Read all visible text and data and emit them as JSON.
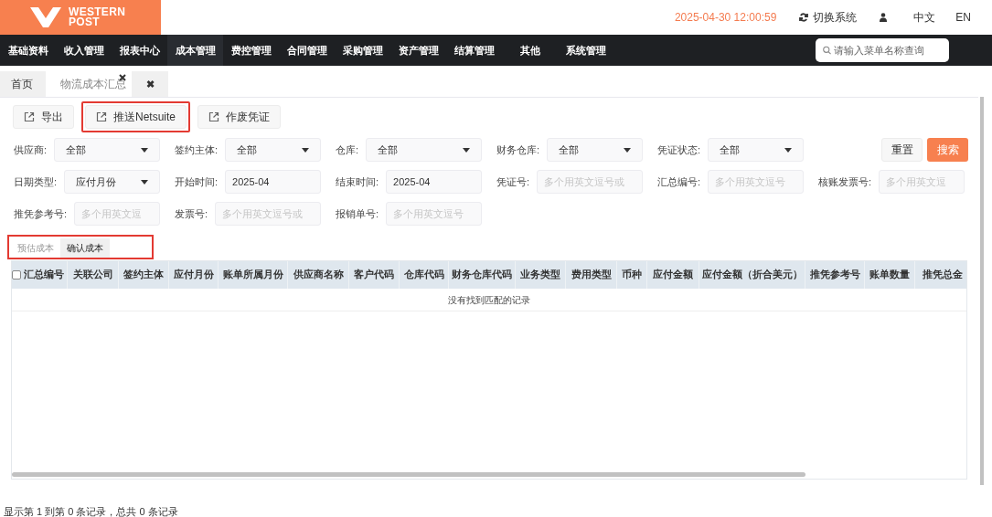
{
  "header": {
    "logo": [
      "WESTERN",
      "POST"
    ],
    "datetime": "2025-04-30 12:00:59",
    "switch_system": "切换系统",
    "languages": [
      "中文",
      "EN"
    ]
  },
  "nav": {
    "items": [
      {
        "label": "基础资料",
        "selected": false
      },
      {
        "label": "收入管理",
        "selected": false
      },
      {
        "label": "报表中心",
        "selected": false
      },
      {
        "label": "成本管理",
        "selected": true
      },
      {
        "label": "费控管理",
        "selected": false
      },
      {
        "label": "合同管理",
        "selected": false
      },
      {
        "label": "采购管理",
        "selected": false
      },
      {
        "label": "资产管理",
        "selected": false
      },
      {
        "label": "结算管理",
        "selected": false
      },
      {
        "label": "其他",
        "selected": false
      },
      {
        "label": "系统管理",
        "selected": false
      }
    ],
    "search_placeholder": "请输入菜单名称查询"
  },
  "page_tabs": [
    {
      "label": "首页",
      "selected": false,
      "closable": false
    },
    {
      "label": "物流成本汇总",
      "selected": true,
      "closable": true
    }
  ],
  "close_all": "✖",
  "toolbar": [
    {
      "label": "导出",
      "highlighted": false
    },
    {
      "label": "推送Netsuite",
      "highlighted": true
    },
    {
      "label": "作废凭证",
      "highlighted": false
    }
  ],
  "filter_rows": [
    [
      {
        "label": "供应商:",
        "kind": "select",
        "value": "全部"
      },
      {
        "label": "签约主体:",
        "kind": "select",
        "value": "全部"
      },
      {
        "label": "仓库:",
        "kind": "select",
        "value": "全部"
      },
      {
        "label": "财务仓库:",
        "kind": "select",
        "value": "全部"
      },
      {
        "label": "凭证状态:",
        "kind": "select",
        "value": "全部"
      }
    ],
    [
      {
        "label": "日期类型:",
        "kind": "select",
        "value": "应付月份"
      },
      {
        "label": "开始时间:",
        "kind": "input",
        "value": "2025-04"
      },
      {
        "label": "结束时间:",
        "kind": "input",
        "value": "2025-04"
      },
      {
        "label": "凭证号:",
        "kind": "input",
        "placeholder": "多个用英文逗号或"
      },
      {
        "label": "汇总编号:",
        "kind": "input",
        "placeholder": "多个用英文逗号"
      },
      {
        "label": "核账发票号:",
        "kind": "input",
        "placeholder": "多个用英文逗"
      }
    ],
    [
      {
        "label": "推凭参考号:",
        "kind": "input",
        "placeholder": "多个用英文逗"
      },
      {
        "label": "发票号:",
        "kind": "input",
        "placeholder": "多个用英文逗号或"
      },
      {
        "label": "报销单号:",
        "kind": "input",
        "placeholder": "多个用英文逗号"
      }
    ]
  ],
  "actions": {
    "reset": "重置",
    "search": "搜索"
  },
  "cost_tabs": {
    "highlighted": true,
    "items": [
      {
        "label": "预估成本",
        "selected": false
      },
      {
        "label": "确认成本",
        "selected": true
      }
    ]
  },
  "table": {
    "select_all": {
      "checked": false
    },
    "columns": [
      "汇总编号",
      "关联公司",
      "签约主体",
      "应付月份",
      "账单所属月份",
      "供应商名称",
      "客户代码",
      "仓库代码",
      "财务仓库代码",
      "业务类型",
      "费用类型",
      "币种",
      "应付金额",
      "应付金额（折合美元）",
      "推凭参考号",
      "账单数量",
      "推凭总金"
    ],
    "empty_message": "没有找到匹配的记录"
  },
  "footer": "显示第 1 到第 0 条记录，总共 0 条记录"
}
